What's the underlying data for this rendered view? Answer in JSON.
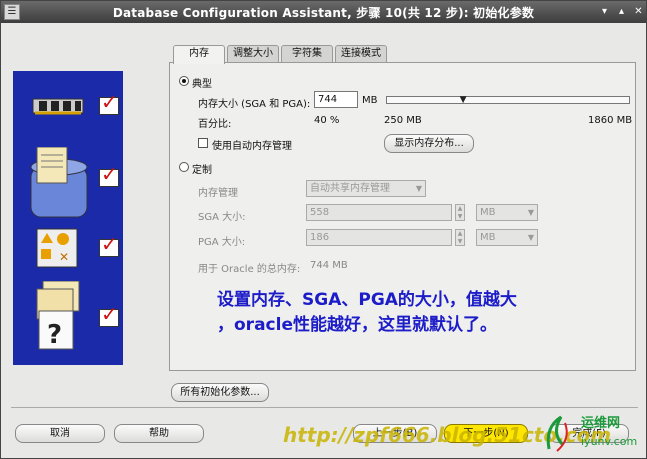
{
  "window": {
    "title": "Database Configuration Assistant, 步骤 10(共 12 步): 初始化参数",
    "menu_icon": "☰",
    "controls": [
      "▾",
      "▴",
      "✕"
    ]
  },
  "tabs": [
    {
      "label": "内存",
      "active": true
    },
    {
      "label": "调整大小",
      "active": false
    },
    {
      "label": "字符集",
      "active": false
    },
    {
      "label": "连接模式",
      "active": false
    }
  ],
  "memory": {
    "typical": {
      "label": "典型",
      "selected": true,
      "size_label": "内存大小 (SGA 和 PGA):",
      "size_value": "744",
      "size_unit": "MB",
      "percent_label": "百分比:",
      "percent_value": "40 %",
      "slider_min": "250 MB",
      "slider_max": "1860 MB",
      "slider_fraction": 0.305,
      "amm_label": "使用自动内存管理",
      "amm_checked": false,
      "show_dist_button": "显示内存分布..."
    },
    "custom": {
      "label": "定制",
      "selected": false,
      "mgmt_label": "内存管理",
      "mgmt_value": "自动共享内存管理",
      "sga_label": "SGA 大小:",
      "sga_value": "558",
      "sga_unit": "MB",
      "pga_label": "PGA 大小:",
      "pga_value": "186",
      "pga_unit": "MB",
      "total_label": "用于 Oracle 的总内存:",
      "total_value": "744 MB"
    }
  },
  "annotation": {
    "line1": "设置内存、SGA、PGA的大小，值越大",
    "line2": "，oracle性能越好，这里就默认了。"
  },
  "all_params_button": "所有初始化参数...",
  "footer": {
    "cancel": "取消",
    "help": "帮助",
    "back": "上一步(B)",
    "next": "下一步(N)",
    "finish": "完成(F)"
  },
  "watermark": "http://zpf666.blog.51cto.com",
  "logo": {
    "title": "运维网",
    "url": "iyunv.com"
  },
  "colors": {
    "side_panel": "#1a2aa8",
    "check": "#d01010",
    "annotation": "#1c1cc8",
    "next_button": "#ffe600"
  }
}
